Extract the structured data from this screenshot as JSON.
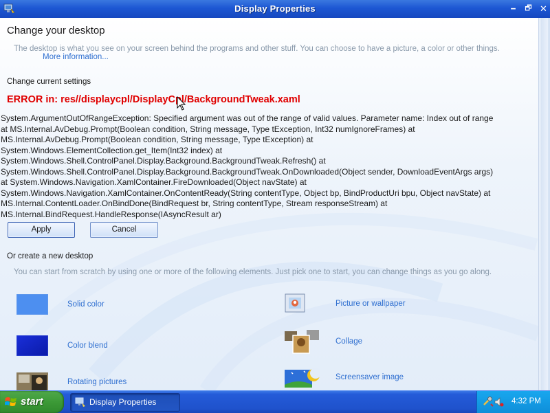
{
  "window": {
    "title": "Display Properties",
    "min_glyph": "🗕",
    "max_glyph": "🗗",
    "close_glyph": "✕"
  },
  "page": {
    "title": "Change your desktop",
    "description": "The desktop is what you see on your screen behind the programs and other stuff. You can choose to have a picture, a color or other things.",
    "more_link": "More information...",
    "current_settings_heading": "Change current settings",
    "error_title": "ERROR in: res//displaycpl/DisplayCpl/BackgroundTweak.xaml",
    "error_trace": "System.ArgumentOutOfRangeException: Specified argument was out of the range of valid values. Parameter name: Index out of range     at MS.Internal.AvDebug.Prompt(Boolean condition, String message, Type tException, Int32 numIgnoreFrames)     at MS.Internal.AvDebug.Prompt(Boolean condition, String message, Type tException)     at System.Windows.ElementCollection.get_Item(Int32 index)     at System.Windows.Shell.ControlPanel.Display.Background.BackgroundTweak.Refresh()     at System.Windows.Shell.ControlPanel.Display.Background.BackgroundTweak.OnDownloaded(Object sender, DownloadEventArgs args)     at System.Windows.Navigation.XamlContainer.FireDownloaded(Object navState)     at System.Windows.Navigation.XamlContainer.OnContentReady(String contentType, Object bp, BindProductUri bpu, Object navState)     at MS.Internal.ContentLoader.OnBindDone(BindRequest br, String contentType, Stream responseStream)     at MS.Internal.BindRequest.HandleResponse(IAsyncResult ar)",
    "apply_label": "Apply",
    "cancel_label": "Cancel",
    "new_desktop_heading": "Or create a new desktop",
    "new_desktop_description": "You can start from scratch by using one or more of the following elements. Just pick one to start, you can change things as you go along."
  },
  "options": {
    "solid_color": "Solid color",
    "color_blend": "Color blend",
    "rotating_pictures": "Rotating pictures",
    "picture_or_wallpaper": "Picture or wallpaper",
    "collage": "Collage",
    "screensaver_image": "Screensaver image"
  },
  "taskbar": {
    "start_label": "start",
    "task_label": "Display Properties",
    "clock": "4:32 PM"
  },
  "colors": {
    "title_bar": "#1d57d3",
    "error_text": "#e00000",
    "link": "#2f6fd0",
    "start_button": "#3c9a37",
    "tray": "#0f8ed9"
  }
}
